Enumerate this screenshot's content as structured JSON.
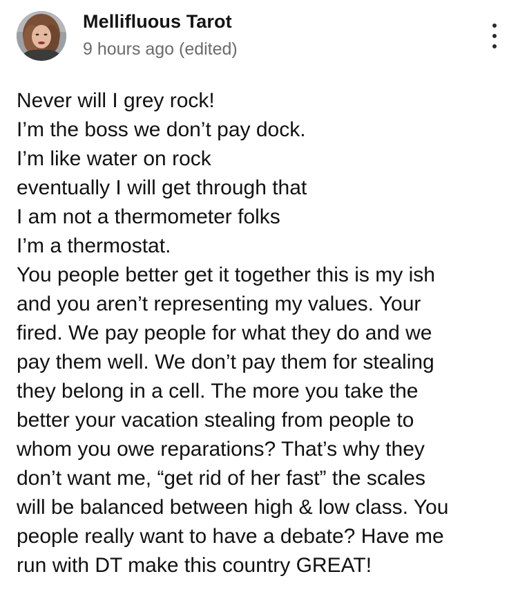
{
  "post": {
    "author": "Mellifluous Tarot",
    "timestamp": "9 hours ago (edited)",
    "avatar_icon": "profile-photo",
    "menu_icon": "more-vertical-icon",
    "lines": [
      "Never will I grey rock!",
      "I’m the boss we don’t pay dock.",
      "I’m like water on rock",
      "eventually I will get through that",
      "I am not a thermometer folks",
      "I’m a thermostat.",
      "You people better get it together this is my ish",
      "and you aren’t representing my values. Your",
      "fired. We pay people for what they do and we",
      "pay them well. We don’t pay them for stealing",
      "they belong in a cell. The more you take the",
      "better your vacation stealing from people to",
      "whom you owe reparations? That’s why they",
      "don’t want me, “get rid of her fast” the scales",
      "will be balanced between high & low class. You",
      "people really want to have a debate? Have me",
      "run with DT make this country GREAT!"
    ]
  }
}
